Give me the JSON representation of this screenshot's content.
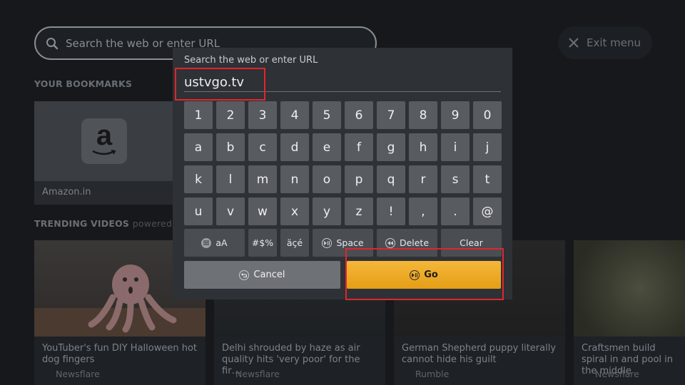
{
  "search_bar": {
    "placeholder": "Search the web or enter URL"
  },
  "exit_menu": {
    "label": "Exit menu"
  },
  "bookmarks": {
    "heading": "YOUR BOOKMARKS",
    "items": [
      {
        "label": "Amazon.in",
        "icon": "amazon-logo-icon"
      }
    ]
  },
  "trending": {
    "heading": "TRENDING VIDEOS",
    "powered_by": "powered by",
    "videos": [
      {
        "title": "YouTuber's fun DIY Halloween hot dog fingers",
        "source": "Newsflare"
      },
      {
        "title": "Delhi shrouded by haze as air quality hits 'very poor' for the fir…",
        "source": "Newsflare"
      },
      {
        "title": "German Shepherd puppy literally cannot hide his guilt",
        "source": "Rumble"
      },
      {
        "title": "Craftsmen build spiral in and pool in the middle",
        "source": "Newsflare"
      }
    ]
  },
  "keyboard": {
    "title": "Search the web or enter URL",
    "url_value": "ustvgo.tv",
    "rows": [
      [
        "1",
        "2",
        "3",
        "4",
        "5",
        "6",
        "7",
        "8",
        "9",
        "0"
      ],
      [
        "a",
        "b",
        "c",
        "d",
        "e",
        "f",
        "g",
        "h",
        "i",
        "j"
      ],
      [
        "k",
        "l",
        "m",
        "n",
        "o",
        "p",
        "q",
        "r",
        "s",
        "t"
      ],
      [
        "u",
        "v",
        "w",
        "x",
        "y",
        "z",
        "!",
        ",",
        ".",
        "@"
      ]
    ],
    "function_keys": {
      "case": "aA",
      "symbols": "#$%",
      "accents": "äçé",
      "space": "Space",
      "delete": "Delete",
      "clear": "Clear"
    },
    "cancel_label": "Cancel",
    "go_label": "Go"
  },
  "colors": {
    "go_button": "#f0aa2a",
    "highlight": "#e0262c",
    "dialog": "#2e3135"
  }
}
